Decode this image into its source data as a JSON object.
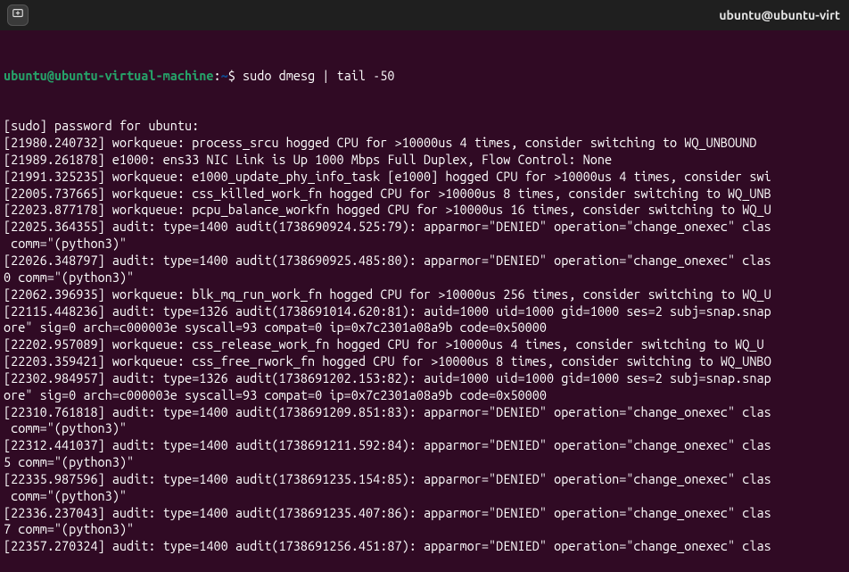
{
  "window": {
    "title": "ubuntu@ubuntu-virt"
  },
  "prompt": {
    "userhost": "ubuntu@ubuntu-virtual-machine",
    "sep": ":",
    "path": "~",
    "dollar": "$ ",
    "command": "sudo dmesg | tail -50"
  },
  "lines": [
    "[sudo] password for ubuntu:",
    "[21980.240732] workqueue: process_srcu hogged CPU for >10000us 4 times, consider switching to WQ_UNBOUND",
    "[21989.261878] e1000: ens33 NIC Link is Up 1000 Mbps Full Duplex, Flow Control: None",
    "[21991.325235] workqueue: e1000_update_phy_info_task [e1000] hogged CPU for >10000us 4 times, consider swi",
    "[22005.737665] workqueue: css_killed_work_fn hogged CPU for >10000us 8 times, consider switching to WQ_UNB",
    "[22023.877178] workqueue: pcpu_balance_workfn hogged CPU for >10000us 16 times, consider switching to WQ_U",
    "[22025.364355] audit: type=1400 audit(1738690924.525:79): apparmor=\"DENIED\" operation=\"change_onexec\" clas",
    " comm=\"(python3)\"",
    "[22026.348797] audit: type=1400 audit(1738690925.485:80): apparmor=\"DENIED\" operation=\"change_onexec\" clas",
    "0 comm=\"(python3)\"",
    "[22062.396935] workqueue: blk_mq_run_work_fn hogged CPU for >10000us 256 times, consider switching to WQ_U",
    "[22115.448236] audit: type=1326 audit(1738691014.620:81): auid=1000 uid=1000 gid=1000 ses=2 subj=snap.snap",
    "ore\" sig=0 arch=c000003e syscall=93 compat=0 ip=0x7c2301a08a9b code=0x50000",
    "[22202.957089] workqueue: css_release_work_fn hogged CPU for >10000us 4 times, consider switching to WQ_U",
    "[22203.359421] workqueue: css_free_rwork_fn hogged CPU for >10000us 8 times, consider switching to WQ_UNBO",
    "[22302.984957] audit: type=1326 audit(1738691202.153:82): auid=1000 uid=1000 gid=1000 ses=2 subj=snap.snap",
    "ore\" sig=0 arch=c000003e syscall=93 compat=0 ip=0x7c2301a08a9b code=0x50000",
    "[22310.761818] audit: type=1400 audit(1738691209.851:83): apparmor=\"DENIED\" operation=\"change_onexec\" clas",
    " comm=\"(python3)\"",
    "[22312.441037] audit: type=1400 audit(1738691211.592:84): apparmor=\"DENIED\" operation=\"change_onexec\" clas",
    "5 comm=\"(python3)\"",
    "[22335.987596] audit: type=1400 audit(1738691235.154:85): apparmor=\"DENIED\" operation=\"change_onexec\" clas",
    " comm=\"(python3)\"",
    "[22336.237043] audit: type=1400 audit(1738691235.407:86): apparmor=\"DENIED\" operation=\"change_onexec\" clas",
    "7 comm=\"(python3)\"",
    "[22357.270324] audit: type=1400 audit(1738691256.451:87): apparmor=\"DENIED\" operation=\"change_onexec\" clas"
  ]
}
